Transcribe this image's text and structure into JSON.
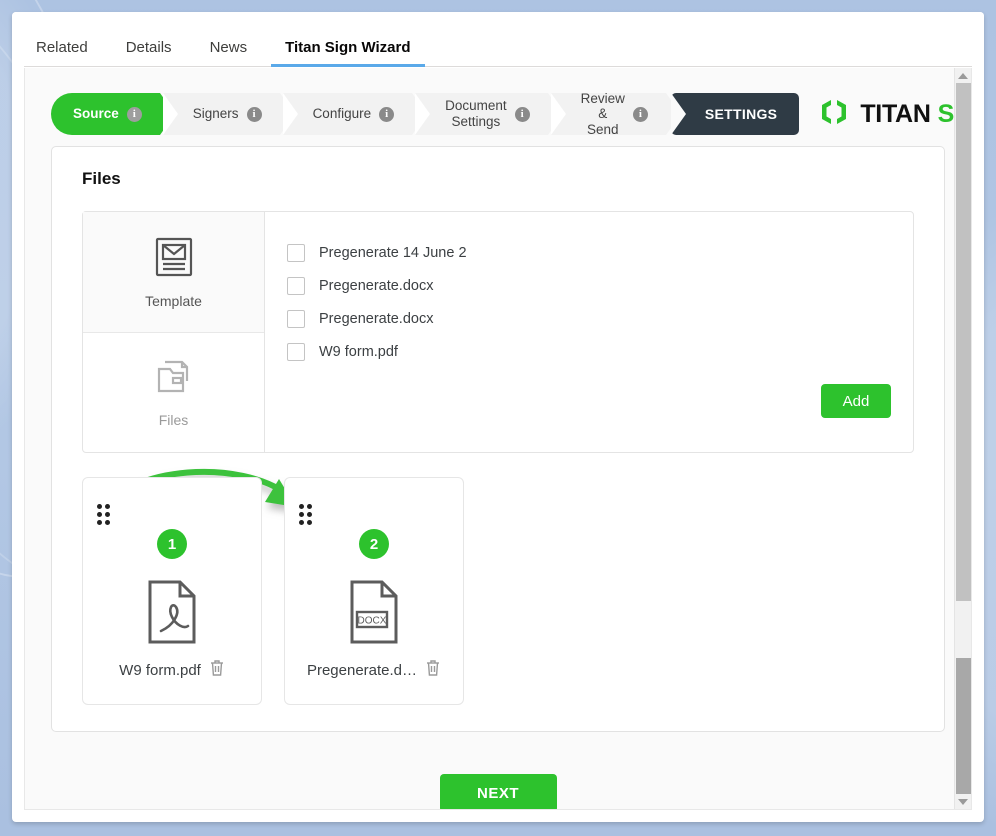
{
  "tabs": [
    {
      "label": "Related",
      "active": false
    },
    {
      "label": "Details",
      "active": false
    },
    {
      "label": "News",
      "active": false
    },
    {
      "label": "Titan Sign Wizard",
      "active": true
    }
  ],
  "wizard": {
    "steps": [
      {
        "label": "Source",
        "active": true,
        "info": "i"
      },
      {
        "label": "Signers",
        "active": false,
        "info": "i"
      },
      {
        "label": "Configure",
        "active": false,
        "info": "i"
      },
      {
        "label": "Document\nSettings",
        "active": false,
        "info": "i"
      },
      {
        "label": "Review\n& Send",
        "active": false,
        "info": "i"
      }
    ],
    "settings_label": "SETTINGS",
    "logo": {
      "titan": "TITAN",
      "sign": "SIGN",
      "icon": "titan-sign-logo-icon"
    }
  },
  "panel": {
    "title": "Files",
    "source_nav": [
      {
        "label": "Template",
        "icon": "template-icon",
        "selected": true
      },
      {
        "label": "Files",
        "icon": "folder-files-icon",
        "selected": false
      }
    ],
    "file_list": [
      {
        "name": "Pregenerate 14 June 2",
        "checked": false
      },
      {
        "name": "Pregenerate.docx",
        "checked": false
      },
      {
        "name": "Pregenerate.docx",
        "checked": false
      },
      {
        "name": "W9 form.pdf",
        "checked": false
      }
    ],
    "add_label": "Add",
    "documents": [
      {
        "order": "1",
        "name": "W9 form.pdf",
        "type": "pdf",
        "type_label": ""
      },
      {
        "order": "2",
        "name": "Pregenerate.d…",
        "type": "docx",
        "type_label": "DOCX"
      }
    ]
  },
  "footer": {
    "next_label": "NEXT"
  },
  "colors": {
    "brand_green": "#2dc22d",
    "settings_dark": "#2f3b45",
    "tab_accent": "#5aa9e9",
    "page_bg": "#a9c1e0"
  },
  "scrollbar": {
    "up_arrow": "scroll-up-arrow-icon",
    "down_arrow": "scroll-down-arrow-icon"
  }
}
